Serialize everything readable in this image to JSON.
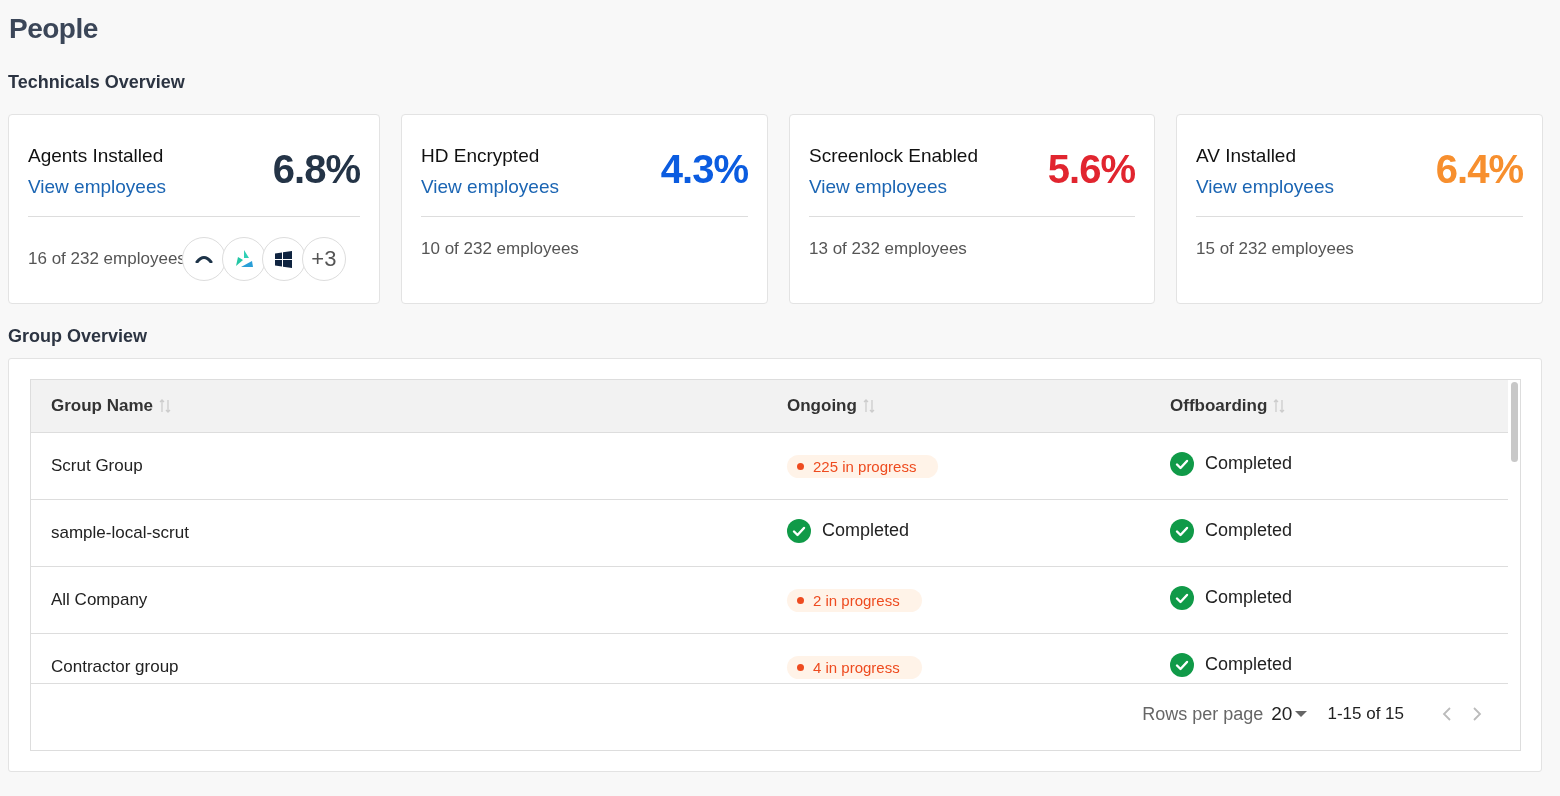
{
  "page_title": "People",
  "technicals": {
    "heading": "Technicals Overview",
    "cards": [
      {
        "title": "Agents Installed",
        "link": "View employees",
        "value": "6.8%",
        "color": "#243447",
        "footer": "16 of 232 employees",
        "more_count": "+3"
      },
      {
        "title": "HD Encrypted",
        "link": "View employees",
        "value": "4.3%",
        "color": "#0b5ce0",
        "footer": "10 of 232 employees"
      },
      {
        "title": "Screenlock Enabled",
        "link": "View employees",
        "value": "5.6%",
        "color": "#e1252f",
        "footer": "13 of 232 employees"
      },
      {
        "title": "AV Installed",
        "link": "View employees",
        "value": "6.4%",
        "color": "#f78f2e",
        "footer": "15 of 232 employees"
      }
    ]
  },
  "groups": {
    "heading": "Group Overview",
    "table": {
      "columns": [
        "Group Name",
        "Ongoing",
        "Offboarding"
      ],
      "rows": [
        {
          "name": "Scrut Group",
          "ongoing": {
            "kind": "progress",
            "text": "225 in progress"
          },
          "offboarding": {
            "kind": "completed",
            "text": "Completed"
          }
        },
        {
          "name": "sample-local-scrut",
          "ongoing": {
            "kind": "completed",
            "text": "Completed"
          },
          "offboarding": {
            "kind": "completed",
            "text": "Completed"
          }
        },
        {
          "name": "All Company",
          "ongoing": {
            "kind": "progress",
            "text": "2 in progress"
          },
          "offboarding": {
            "kind": "completed",
            "text": "Completed"
          }
        },
        {
          "name": "Contractor group",
          "ongoing": {
            "kind": "progress",
            "text": "4 in progress"
          },
          "offboarding": {
            "kind": "completed",
            "text": "Completed"
          }
        }
      ]
    },
    "pagination": {
      "rows_label": "Rows per page",
      "rows_value": "20",
      "range": "1-15 of 15",
      "prev_disabled": true,
      "next_disabled": true
    }
  }
}
